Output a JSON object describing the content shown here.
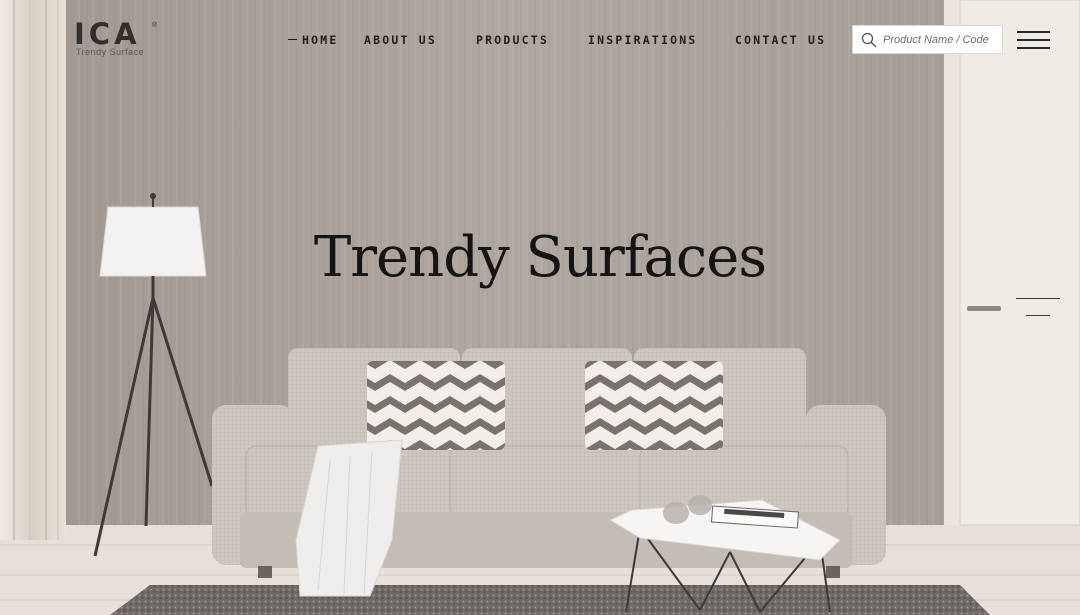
{
  "brand": {
    "logo_text": "ICA",
    "registered": "®",
    "tagline": "Trendy Surface"
  },
  "nav": {
    "items": [
      {
        "label": "HOME",
        "active": true
      },
      {
        "label": "ABOUT US",
        "active": false
      },
      {
        "label": "PRODUCTS",
        "active": false
      },
      {
        "label": "INSPIRATIONS",
        "active": false
      },
      {
        "label": "CONTACT US",
        "active": false
      }
    ]
  },
  "search": {
    "placeholder": "Product Name / Code",
    "value": "",
    "icon": "search-icon"
  },
  "menu": {
    "icon": "hamburger-menu-icon"
  },
  "hero": {
    "title": "Trendy Surfaces"
  },
  "colors": {
    "wall": "#aaa19a",
    "text_dark": "#1d1d1d",
    "search_bg": "#ffffff"
  }
}
